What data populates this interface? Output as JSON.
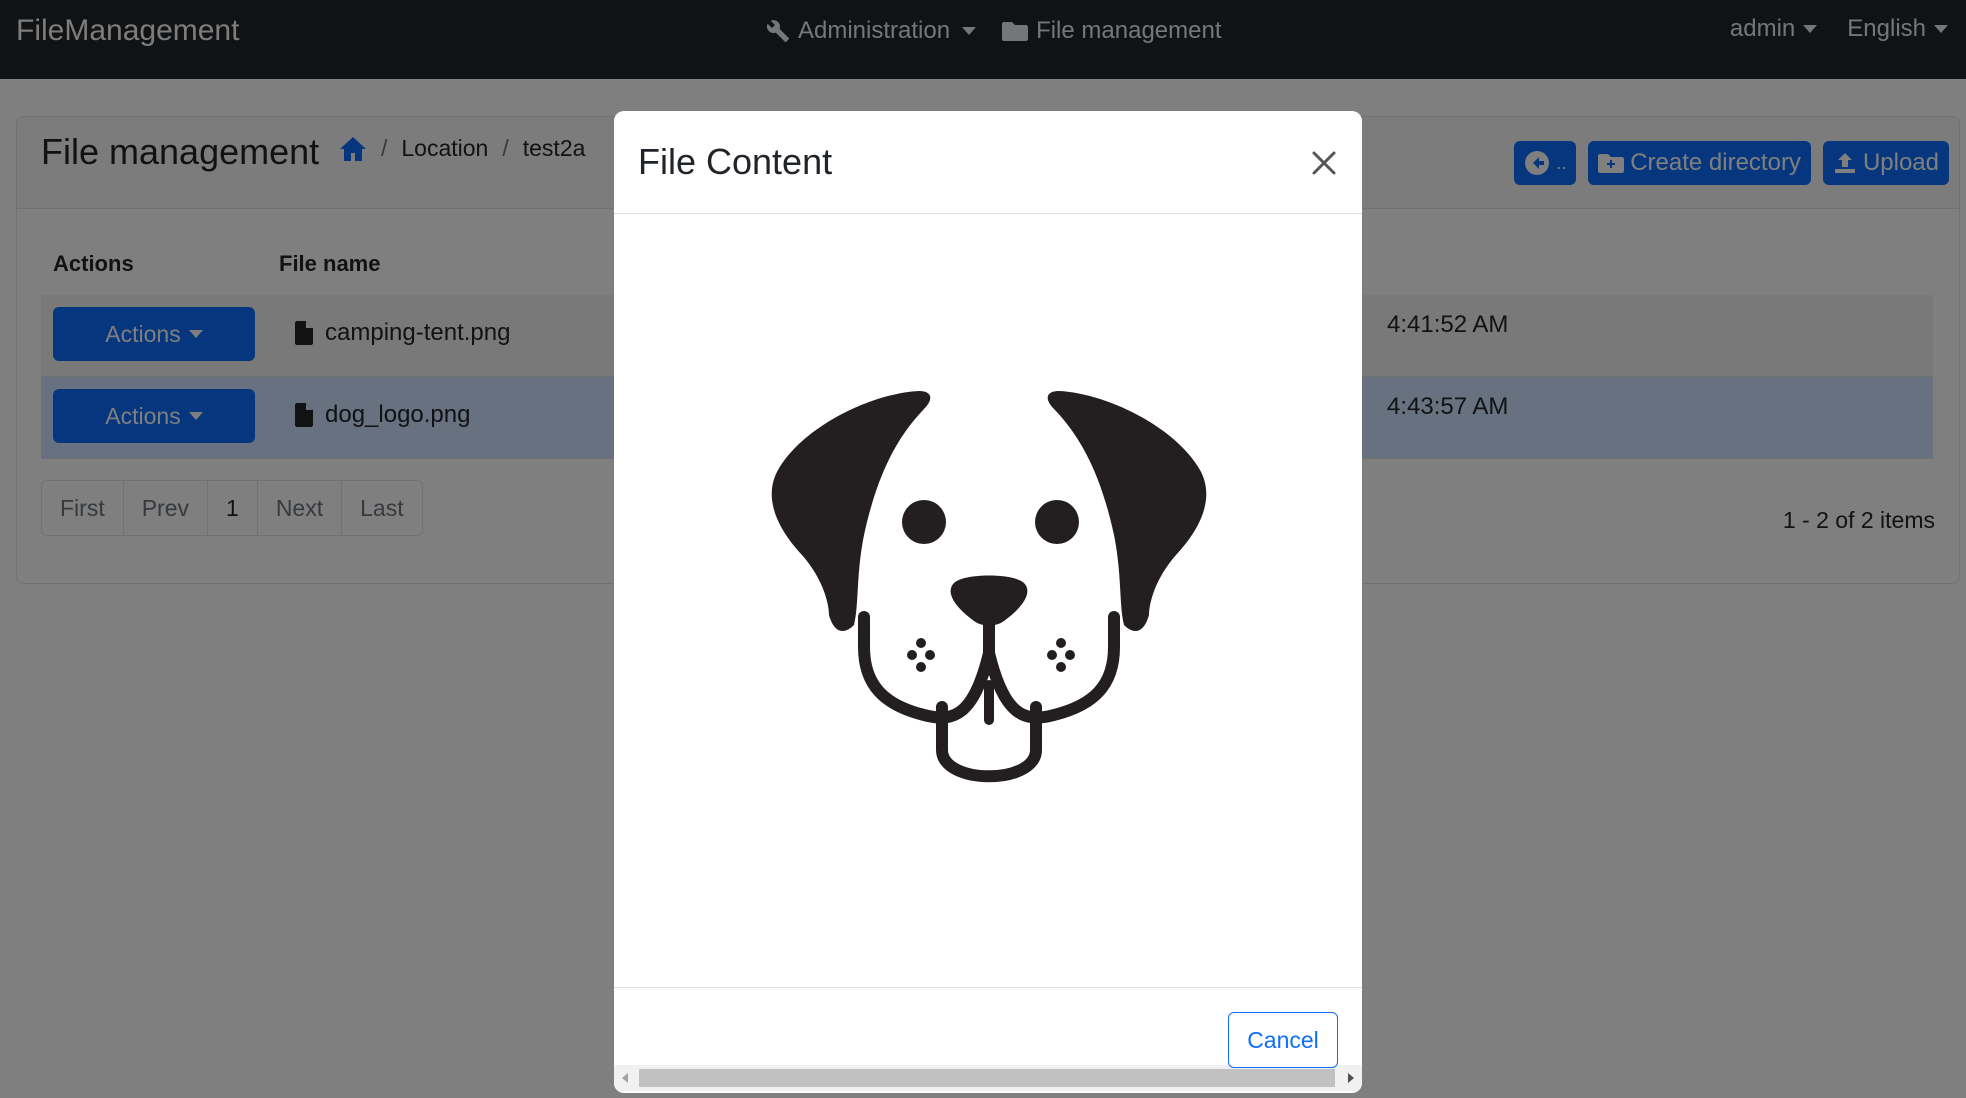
{
  "navbar": {
    "brand": "FileManagement",
    "admin_menu": "Administration",
    "file_menu": "File management",
    "user_menu": "admin",
    "language_menu": "English"
  },
  "page": {
    "title": "File management",
    "breadcrumb": [
      "Location",
      "test2a"
    ],
    "back_button": "..",
    "create_directory": "Create directory",
    "upload": "Upload"
  },
  "table": {
    "columns": [
      "Actions",
      "File name"
    ],
    "rows": [
      {
        "action_label": "Actions",
        "file_name": "camping-tent.png",
        "time": "4:41:52 AM"
      },
      {
        "action_label": "Actions",
        "file_name": "dog_logo.png",
        "time": "4:43:57 AM"
      }
    ]
  },
  "pagination": {
    "first": "First",
    "prev": "Prev",
    "current": "1",
    "next": "Next",
    "last": "Last",
    "summary": "1 - 2 of 2 items"
  },
  "modal": {
    "title": "File Content",
    "cancel": "Cancel"
  },
  "icons": {
    "home": "home-icon",
    "wrench": "wrench-icon",
    "folder": "folder-icon",
    "file": "file-icon",
    "close": "close-icon"
  },
  "colors": {
    "primary": "#0d6efd",
    "navbar": "#212529",
    "selected_row": "#cfe2ff"
  }
}
